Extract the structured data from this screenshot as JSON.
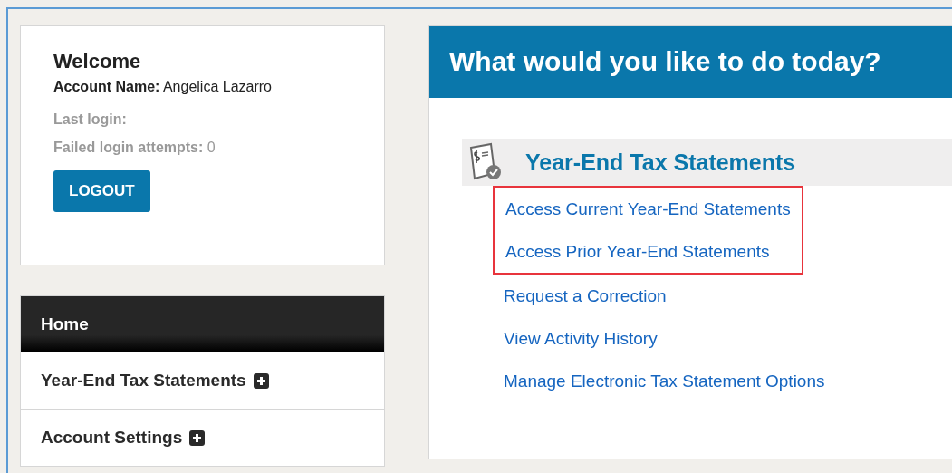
{
  "welcome": {
    "title": "Welcome",
    "account_label": "Account Name:",
    "account_name": "Angelica Lazarro",
    "last_login_label": "Last login:",
    "failed_label": "Failed login attempts:",
    "failed_count": "0",
    "logout_button": "LOGOUT"
  },
  "nav": [
    {
      "label": "Home",
      "selected": true,
      "expandable": false
    },
    {
      "label": "Year-End Tax Statements",
      "selected": false,
      "expandable": true
    },
    {
      "label": "Account Settings",
      "selected": false,
      "expandable": true
    }
  ],
  "main": {
    "heading": "What would you like to do today?",
    "section_title": "Year-End Tax Statements",
    "highlighted_links": [
      "Access Current Year-End Statements",
      "Access Prior Year-End Statements"
    ],
    "links": [
      "Request a Correction",
      "View Activity History",
      "Manage Electronic Tax Statement Options"
    ]
  }
}
